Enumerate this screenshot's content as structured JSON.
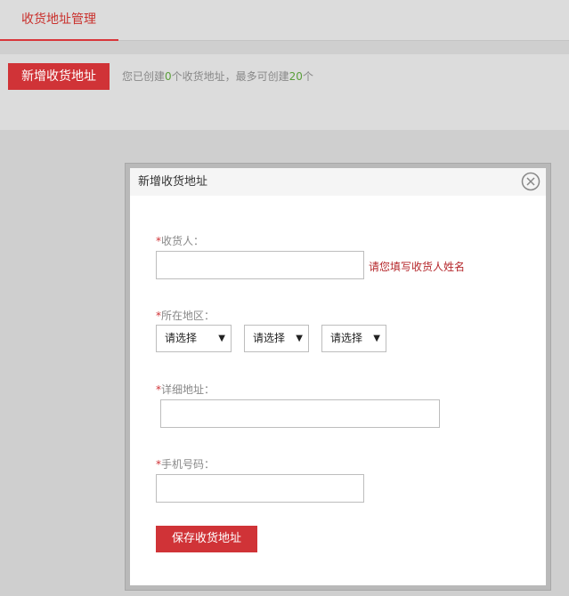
{
  "tabs": {
    "active_label": "收货地址管理"
  },
  "toolbar": {
    "add_label": "新增收货地址",
    "count_prefix": "您已创建",
    "created_count": "0",
    "count_middle": "个收货地址，最多可创建",
    "max_count": "20",
    "count_suffix": "个"
  },
  "modal": {
    "title": "新增收货地址",
    "required_mark": "*",
    "receiver": {
      "label": "收货人：",
      "value": "",
      "error": "请您填写收货人姓名"
    },
    "region": {
      "label": "所在地区：",
      "province": "请选择",
      "city": "请选择",
      "district": "请选择"
    },
    "address": {
      "label": "详细地址：",
      "value": ""
    },
    "phone": {
      "label": "手机号码：",
      "value": ""
    },
    "save_label": "保存收货地址"
  },
  "colors": {
    "accent": "#d03337",
    "count_highlight": "#5a9e3a"
  }
}
